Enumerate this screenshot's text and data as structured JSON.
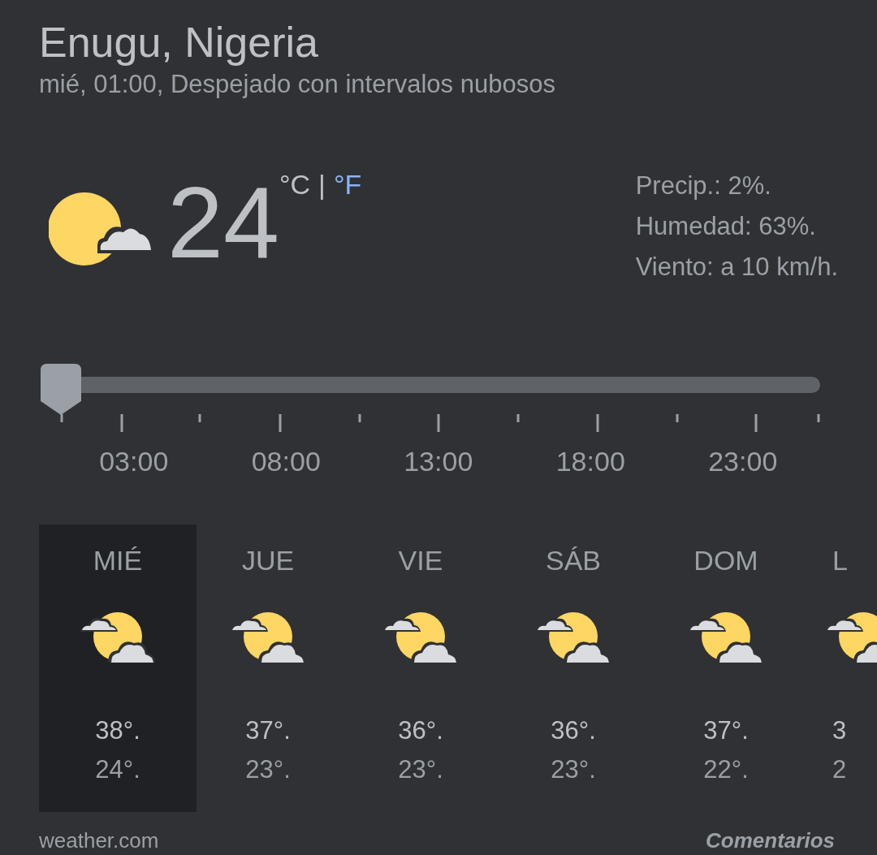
{
  "location": "Enugu, Nigeria",
  "subtitle": "mié, 01:00, Despejado con intervalos nubosos",
  "current": {
    "temperature": "24",
    "units": [
      {
        "label": "°C",
        "selected": true
      },
      {
        "label": "°F",
        "selected": false
      }
    ],
    "separator": "|",
    "details": [
      "Precip.: 2%.",
      "Humedad: 63%.",
      "Viento: a 10 km/h."
    ]
  },
  "slider": {
    "level": 0,
    "hours": [
      "03:00",
      "08:00",
      "13:00",
      "18:00",
      "23:00"
    ]
  },
  "days": [
    {
      "day": "MIÉ",
      "high": "38°.",
      "low": "24°.",
      "selected": true
    },
    {
      "day": "JUE",
      "high": "37°.",
      "low": "23°.",
      "selected": false
    },
    {
      "day": "VIE",
      "high": "36°.",
      "low": "23°.",
      "selected": false
    },
    {
      "day": "SÁB",
      "high": "36°.",
      "low": "23°.",
      "selected": false
    },
    {
      "day": "DOM",
      "high": "37°.",
      "low": "22°.",
      "selected": false
    },
    {
      "day": "L",
      "high": "3",
      "low": "2",
      "selected": false
    }
  ],
  "footer": {
    "source": "weather.com",
    "feedback": "Comentarios"
  }
}
